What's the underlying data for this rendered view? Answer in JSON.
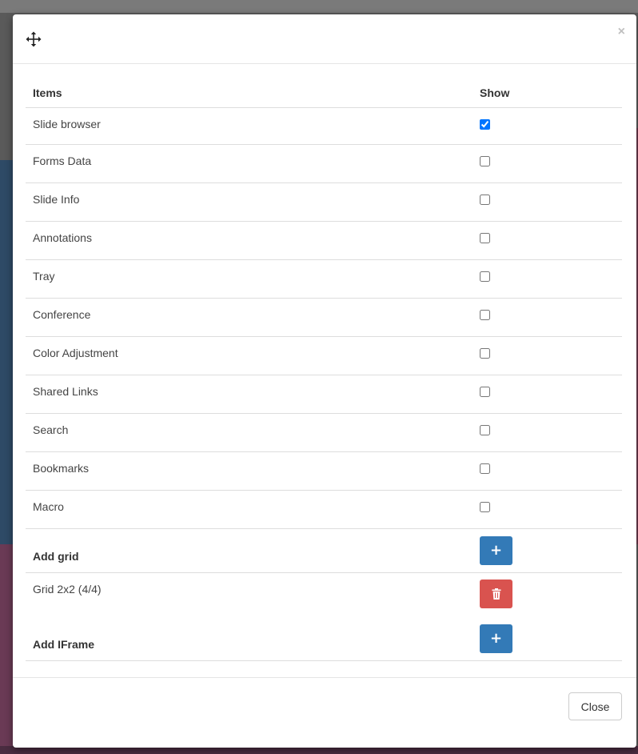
{
  "dialog": {
    "close_x": "×",
    "table": {
      "header_items": "Items",
      "header_show": "Show",
      "rows": [
        {
          "label": "Slide browser",
          "checked": true
        },
        {
          "label": "Forms Data",
          "checked": false
        },
        {
          "label": "Slide Info",
          "checked": false
        },
        {
          "label": "Annotations",
          "checked": false
        },
        {
          "label": "Tray",
          "checked": false
        },
        {
          "label": "Conference",
          "checked": false
        },
        {
          "label": "Color Adjustment",
          "checked": false
        },
        {
          "label": "Shared Links",
          "checked": false
        },
        {
          "label": "Search",
          "checked": false
        },
        {
          "label": "Bookmarks",
          "checked": false
        },
        {
          "label": "Macro",
          "checked": false
        }
      ]
    },
    "add_grid_label": "Add grid",
    "grid_item_label": "Grid 2x2 (4/4)",
    "add_iframe_label": "Add IFrame",
    "plus_glyph": "+",
    "close_button_label": "Close"
  }
}
